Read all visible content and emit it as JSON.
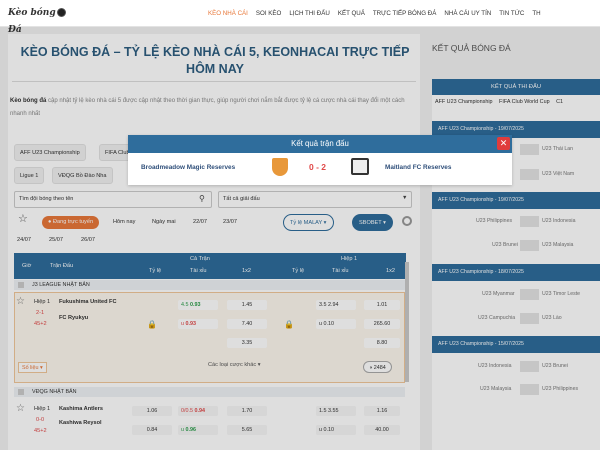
{
  "header": {
    "logo_text": "Kèo bóng",
    "logo_text2": "Đá",
    "nav": [
      {
        "label": "KÈO NHÀ CÁI",
        "active": true
      },
      {
        "label": "SOI KÈO"
      },
      {
        "label": "LỊCH THI ĐẤU"
      },
      {
        "label": "KẾT QUẢ"
      },
      {
        "label": "TRỰC TIẾP BÓNG ĐÁ"
      },
      {
        "label": "NHÀ CÁI UY TÍN"
      },
      {
        "label": "TIN TỨC"
      },
      {
        "label": "TH"
      }
    ]
  },
  "page": {
    "title": "KÈO BÓNG ĐÁ – TỶ LỆ KÈO NHÀ CÁI 5, KEONHACAI TRỰC TIẾP HÔM NAY",
    "intro_bold": "Kèo bóng đá",
    "intro_text": " cập nhật tỷ lệ kèo nhà cái 5 được cập nhật theo thời gian thực, giúp người chơi nắm bắt được tỷ lệ cá cược nhà cái thay đổi một cách nhanh nhất"
  },
  "filters": {
    "league_chips": [
      "AFF U23 Championship",
      "FIFA Club",
      "Ligue 1",
      "VĐQG Bồ Đào Nha"
    ],
    "search_placeholder": "Tìm đội bóng theo tên",
    "league_select": "Tất cả giải đấu",
    "date_chips": [
      "Đang trực tuyến",
      "Hôm nay",
      "Ngày mai",
      "22/07",
      "23/07",
      "24/07",
      "25/07",
      "26/07"
    ],
    "odds_type": "Tỷ lệ MALAY",
    "bookmaker": "SBOBET"
  },
  "table": {
    "headers": {
      "time": "Giờ",
      "match": "Trận Đấu",
      "full": "Cả Trận",
      "half": "Hiệp 1",
      "ty_le": "Tỷ lệ",
      "tai_xiu": "Tài xỉu",
      "x12": "1x2"
    },
    "leagues": [
      {
        "name": "J3 LEAGUE NHẬT BẢN",
        "matches": [
          {
            "time": "Hiệp 1",
            "s1": "2-1",
            "s2": "45+2",
            "home": "Fukushima United FC",
            "away": "FC Ryukyu",
            "full_ou": [
              {
                "l": "4.5",
                "v": "0.93",
                "c": "grn"
              },
              {
                "l": "u",
                "v": "0.93",
                "c": "red"
              }
            ],
            "full_1x2": [
              "1.45",
              "7.40",
              "3.35"
            ],
            "half_ou": [
              {
                "l": "3.5",
                "v": "2.94",
                "c": ""
              },
              {
                "l": "u",
                "v": "0.10",
                "c": ""
              }
            ],
            "half_1x2": [
              "1.01",
              "265.60",
              "8.80"
            ],
            "extra": "Các loại cược khác",
            "stats": "Số liệu",
            "count": "2484"
          }
        ]
      },
      {
        "name": "VĐQG NHẬT BẢN",
        "matches": [
          {
            "time": "Hiệp 1",
            "s1": "0-0",
            "s2": "45+2",
            "home": "Kashima Antlers",
            "away": "Kashiwa Reysol",
            "full_ty": [
              {
                "l": "",
                "v": "1.06"
              },
              {
                "l": "",
                "v": "0.84"
              }
            ],
            "full_ou": [
              {
                "l": "0/0.5",
                "v": "0.94",
                "c": "red"
              },
              {
                "l": "u",
                "v": "0.96",
                "c": "grn"
              }
            ],
            "full_1x2": [
              "1.70",
              "5.65"
            ],
            "half_ou": [
              {
                "l": "1.5",
                "v": "3.55",
                "c": ""
              },
              {
                "l": "u",
                "v": "0.10",
                "c": ""
              }
            ],
            "half_1x2": [
              "1.16",
              "40.00"
            ]
          }
        ]
      }
    ]
  },
  "modal": {
    "title": "Kết quả trận đấu",
    "home": "Broadmeadow Magic Reserves",
    "score": "0 - 2",
    "away": "Maitland FC Reserves"
  },
  "sidebar": {
    "title": "KẾT QUẢ BÓNG ĐÁ",
    "panel_title": "KẾT QUẢ THI ĐẤU",
    "tabs": [
      "AFF U23 Championship",
      "FIFA Club World Cup",
      "C1"
    ],
    "groups": [
      {
        "label": "AFF U23 Championship - 19/07/2025",
        "rows": [
          {
            "home": "",
            "score": "",
            "away": "U23 Thái Lan"
          },
          {
            "home": "",
            "score": "",
            "away": "U23 Việt Nam"
          }
        ]
      },
      {
        "label": "AFF U23 Championship - 19/07/2025",
        "rows": [
          {
            "home": "U23 Philippines",
            "score": "",
            "away": "U23 Indonesia"
          },
          {
            "home": "U23 Brunei",
            "score": "",
            "away": "U23 Malaysia"
          }
        ]
      },
      {
        "label": "AFF U23 Championship - 18/07/2025",
        "rows": [
          {
            "home": "U23 Myanmar",
            "score": "",
            "away": "U23 Timor Leste"
          },
          {
            "home": "U23 Campuchia",
            "score": "",
            "away": "U23 Lào"
          }
        ]
      },
      {
        "label": "AFF U23 Championship - 15/07/2025",
        "rows": [
          {
            "home": "U23 Indonesia",
            "score": "",
            "away": "U23 Brunei"
          },
          {
            "home": "U23 Malaysia",
            "score": "",
            "away": "U23 Philippines"
          }
        ]
      }
    ]
  }
}
